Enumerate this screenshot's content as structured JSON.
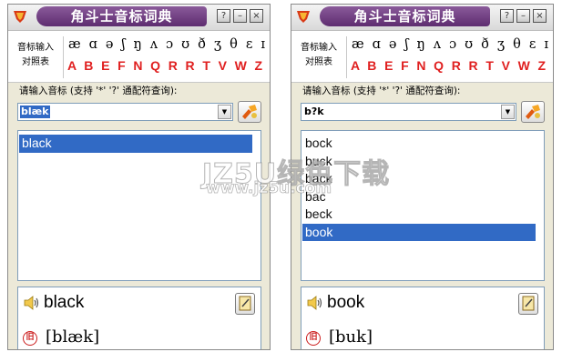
{
  "app_title": "角斗士音标词典",
  "title_buttons": {
    "help": "?",
    "minimize": "–",
    "close": "×"
  },
  "ipa_panel": {
    "label_line1": "音标输入",
    "label_line2": "对照表",
    "symbols": "æ ɑ ə ʃ ŋ ʌ ɔ ʊ ð ʒ θ ɛ ɪ ʊ",
    "keys": "A B E F N Q R R T V W Z I U"
  },
  "search_prompt": "请输入音标 (支持 '*'  '?'  通配符查询):",
  "windows": [
    {
      "query": "blæk",
      "query_selected": true,
      "results": [
        "black"
      ],
      "selected_index": 0,
      "detail_word": "black",
      "detail_phonetic": "[blæk]"
    },
    {
      "query": "b?k",
      "query_selected": false,
      "results": [
        "bock",
        "buck",
        "back",
        "bac",
        "beck",
        "book"
      ],
      "selected_index": 5,
      "detail_word": "book",
      "detail_phonetic": "[buk]"
    }
  ],
  "phonetic_icon_text": "旧",
  "watermark": {
    "line1": "JZ5U绿色下载",
    "line2": "www.jz5u.com"
  },
  "colors": {
    "selection": "#316ac5",
    "title_plate": "#5e2d70",
    "ipa_keys": "#e02020"
  }
}
